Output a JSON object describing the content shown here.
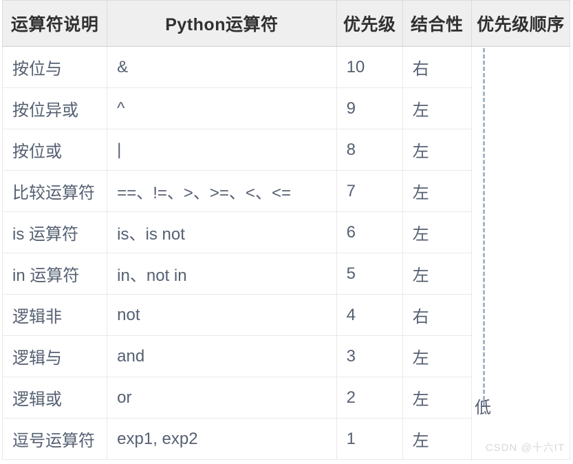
{
  "table": {
    "columns": [
      {
        "key": "desc",
        "label": "运算符说明"
      },
      {
        "key": "op",
        "label": "Python运算符"
      },
      {
        "key": "prec",
        "label": "优先级"
      },
      {
        "key": "assoc",
        "label": "结合性"
      },
      {
        "key": "order",
        "label": "优先级顺序"
      }
    ],
    "rows": [
      {
        "desc": "按位与",
        "op": "&",
        "prec": "10",
        "assoc": "右"
      },
      {
        "desc": "按位异或",
        "op": "^",
        "prec": "9",
        "assoc": "左"
      },
      {
        "desc": "按位或",
        "op": "|",
        "prec": "8",
        "assoc": "左"
      },
      {
        "desc": "比较运算符",
        "op": "==、!=、>、>=、<、<=",
        "prec": "7",
        "assoc": "左"
      },
      {
        "desc": "is 运算符",
        "op": "is、is not",
        "prec": "6",
        "assoc": "左"
      },
      {
        "desc": "in 运算符",
        "op": "in、not in",
        "prec": "5",
        "assoc": "左"
      },
      {
        "desc": "逻辑非",
        "op": "not",
        "prec": "4",
        "assoc": "右"
      },
      {
        "desc": "逻辑与",
        "op": "and",
        "prec": "3",
        "assoc": "左"
      },
      {
        "desc": "逻辑或",
        "op": "or",
        "prec": "2",
        "assoc": "左"
      },
      {
        "desc": "逗号运算符",
        "op": "exp1, exp2",
        "prec": "1",
        "assoc": "左"
      }
    ]
  },
  "order_indicator": {
    "low_label": "低",
    "line_color": "#9fb6cd",
    "style": "dashed-vertical"
  },
  "watermark": {
    "text": "CSDN @十六IT",
    "color": "#d8d8d8"
  },
  "colors": {
    "header_bg": "#efefef",
    "header_text": "#303030",
    "body_bg": "#ffffff",
    "body_text": "#566072",
    "grid_line": "#e9e9e9"
  }
}
